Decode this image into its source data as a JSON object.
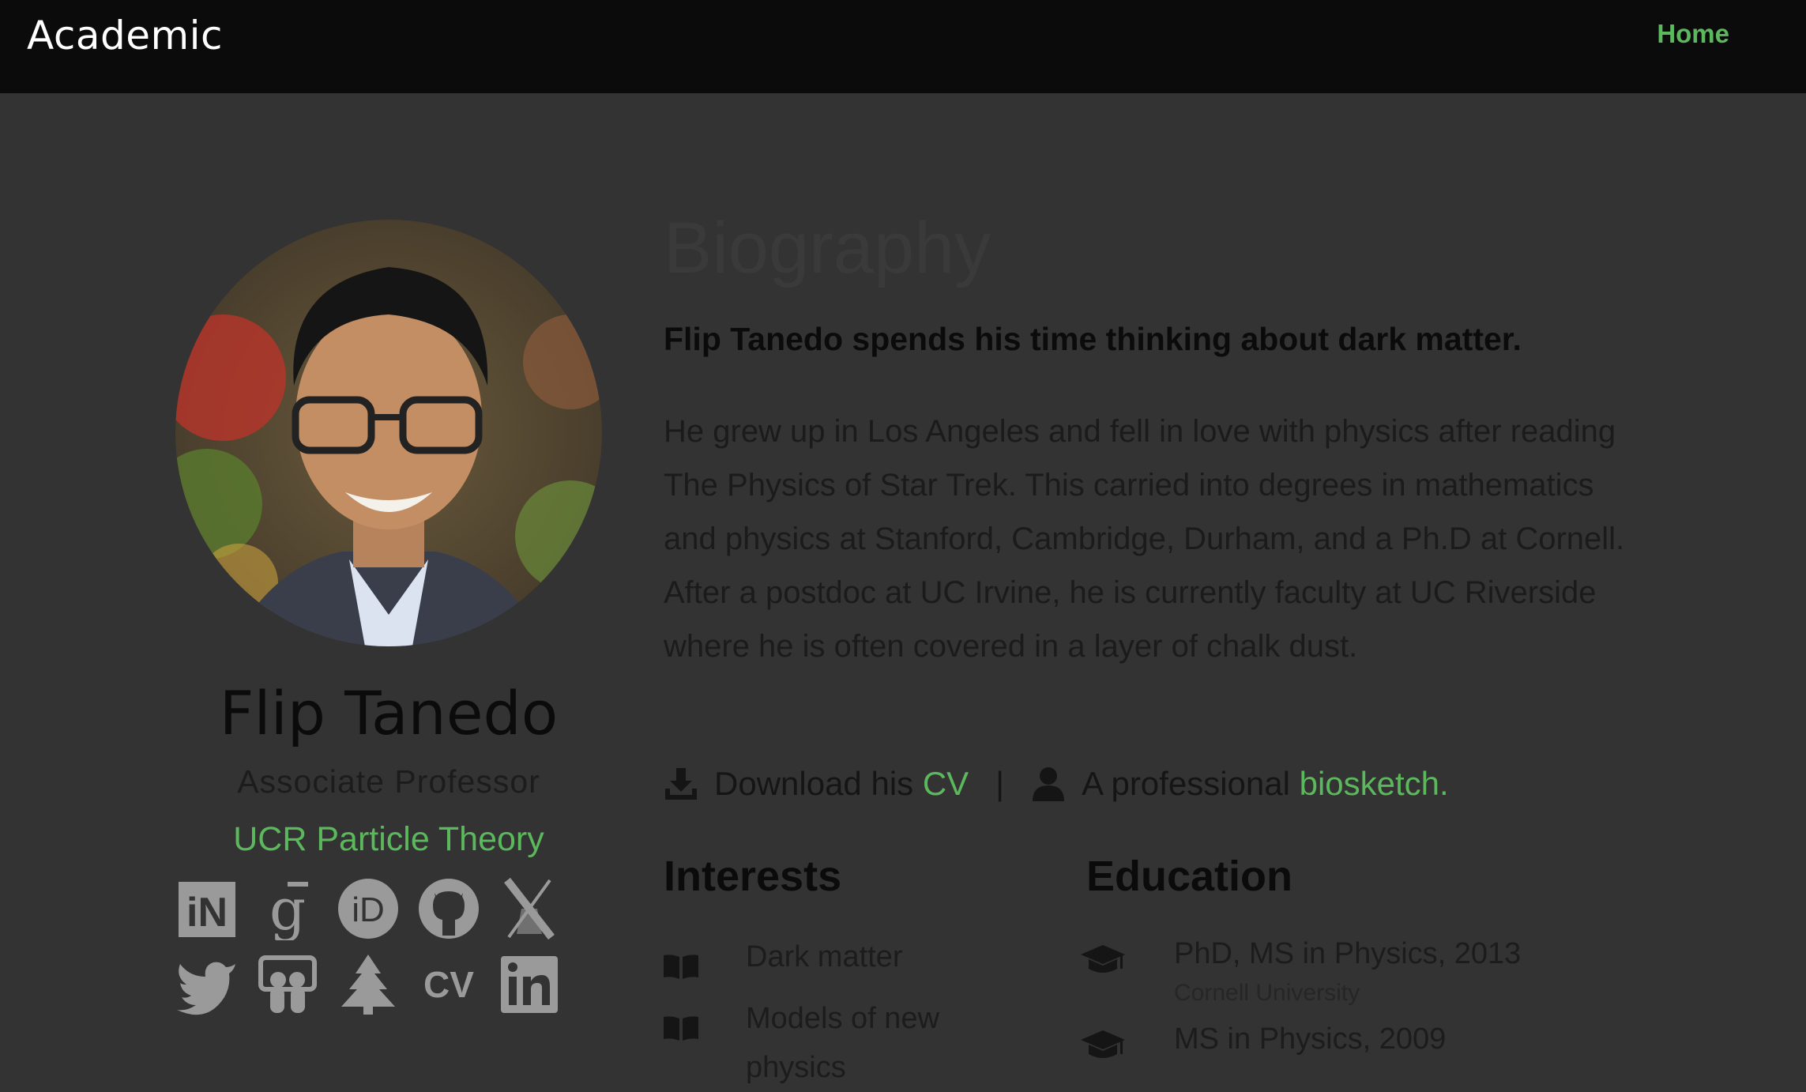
{
  "navbar": {
    "brand": "Academic",
    "home_label": "Home",
    "accent_color": "#5cb85c"
  },
  "profile": {
    "name": "Flip Tanedo",
    "role": "Associate Professor",
    "organization": "UCR Particle Theory",
    "social_icons": [
      [
        "inspire-icon",
        "google-scholar-icon",
        "orcid-icon",
        "github-icon",
        "x-twitter-icon"
      ],
      [
        "twitter-bird-icon",
        "slideshare-icon",
        "tree-icon",
        "cv-icon",
        "linkedin-icon"
      ]
    ]
  },
  "biography": {
    "title": "Biography",
    "lead": "Flip Tanedo spends his time thinking about dark matter.",
    "body": "He grew up in Los Angeles and fell in love with physics after reading The Physics of Star Trek. This carried into degrees in mathematics and physics at Stanford, Cambridge, Durham, and a Ph.D at Cornell. After a postdoc at UC Irvine, he is currently faculty at UC Riverside where he is often covered in a layer of chalk dust.",
    "links": {
      "download_prefix": "Download his ",
      "cv_label": "CV",
      "separator": "|",
      "bio_prefix": "A professional ",
      "biosketch_label": "biosketch",
      "bio_suffix": "."
    }
  },
  "interests": {
    "title": "Interests",
    "items": [
      "Dark matter",
      "Models of new physics"
    ]
  },
  "education": {
    "title": "Education",
    "items": [
      {
        "degree": "PhD, MS in Physics, 2013",
        "institution": "Cornell University"
      },
      {
        "degree": "MS in Physics, 2009",
        "institution": ""
      }
    ]
  }
}
